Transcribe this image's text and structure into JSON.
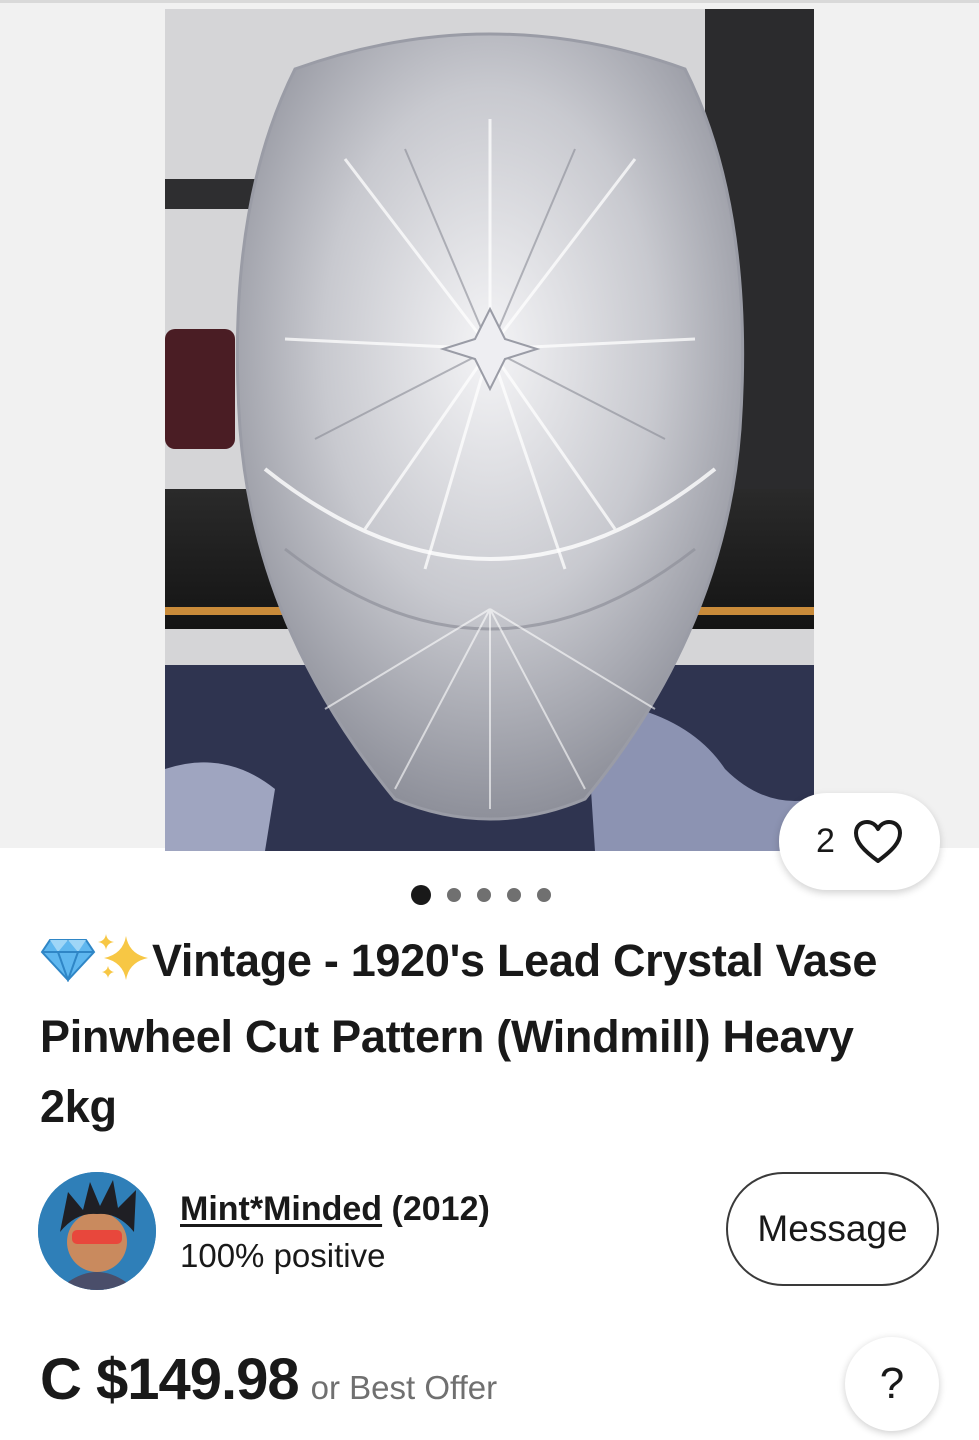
{
  "listing": {
    "title": "Vintage - 1920's Lead Crystal Vase Pinwheel Cut Pattern (Windmill) Heavy 2kg",
    "title_emoji": [
      "gem-icon",
      "sparkles-icon"
    ],
    "watch_count": "2",
    "image_count": 5,
    "active_image_index": 0,
    "photo_subject": "cut-crystal-vase-photo"
  },
  "seller": {
    "name": "Mint*Minded",
    "feedback_score": "(2012)",
    "feedback_percent": "100% positive",
    "message_label": "Message"
  },
  "price": {
    "amount": "C $149.98",
    "offer_text": "or Best Offer"
  },
  "help": {
    "label": "?"
  },
  "colors": {
    "text": "#191919",
    "muted": "#707070",
    "border": "#3a3a3a",
    "gallery_bg": "#f1f1f1"
  }
}
